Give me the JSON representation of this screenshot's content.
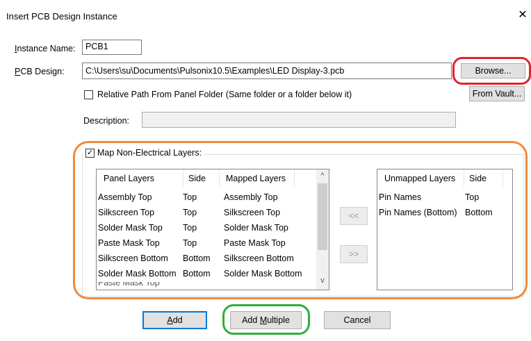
{
  "window": {
    "title": "Insert PCB Design Instance",
    "close_glyph": "✕"
  },
  "form": {
    "instance_label_prefix": "",
    "instance_label_u": "I",
    "instance_label_rest": "nstance Name:",
    "instance_value": "PCB1",
    "pcb_label_prefix": "",
    "pcb_label_u": "P",
    "pcb_label_rest": "CB Design:",
    "pcb_path": "C:\\Users\\su\\Documents\\Pulsonix10.5\\Examples\\LED Display-3.pcb",
    "browse_label": "Browse...",
    "relative_path_label": "Relative Path From Panel Folder (Same folder or a folder below it)",
    "relative_path_checked": false,
    "from_vault_label": "From Vault...",
    "description_label": "Description:",
    "description_value": ""
  },
  "map_layers": {
    "checkbox_label": "Map Non-Electrical Layers:",
    "checked": true,
    "check_glyph": "✓",
    "mapped_columns": [
      "Panel Layers",
      "Side",
      "Mapped Layers"
    ],
    "mapped_rows": [
      [
        "Assembly Top",
        "Top",
        "Assembly Top"
      ],
      [
        "Silkscreen Top",
        "Top",
        "Silkscreen Top"
      ],
      [
        "Solder Mask Top",
        "Top",
        "Solder Mask Top"
      ],
      [
        "Paste Mask Top",
        "Top",
        "Paste Mask Top"
      ],
      [
        "Silkscreen Bottom",
        "Bottom",
        "Silkscreen Bottom"
      ],
      [
        "Solder Mask Bottom",
        "Bottom",
        "Solder Mask Bottom"
      ]
    ],
    "move_left_label": "<<",
    "move_right_label": ">>",
    "unmapped_columns": [
      "Unmapped Layers",
      "Side"
    ],
    "unmapped_rows": [
      [
        "Pin Names",
        "Top"
      ],
      [
        "Pin Names (Bottom)",
        "Bottom"
      ]
    ],
    "scroll_up_glyph": "^",
    "scroll_down_glyph": "v"
  },
  "buttons": {
    "add_u": "A",
    "add_rest": "dd",
    "add_multiple_prefix": "Add ",
    "add_multiple_u": "M",
    "add_multiple_rest": "ultiple",
    "cancel": "Cancel"
  },
  "colors": {
    "highlight_red": "#e0222c",
    "highlight_orange": "#f08a3c",
    "highlight_green": "#2fae3a",
    "default_button_border": "#0078d7"
  }
}
